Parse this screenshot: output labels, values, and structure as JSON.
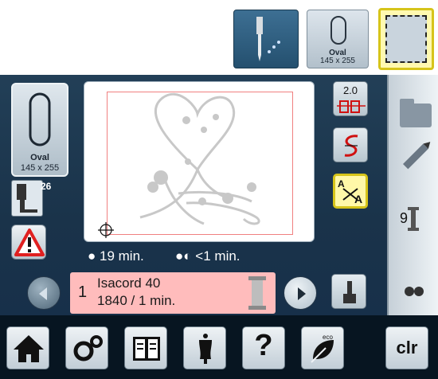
{
  "top": {
    "hoop_name": "Oval",
    "hoop_size": "145 x 255"
  },
  "hoop": {
    "name": "Oval",
    "size": "145 x 255"
  },
  "presser_foot": {
    "number": "26"
  },
  "scale": {
    "value": "2.0"
  },
  "times": {
    "total": "19 min.",
    "color": "<1 min."
  },
  "thread": {
    "index": "1",
    "brand": "Isacord 40",
    "detail": "1840 / 1 min.",
    "color": "#ffbcbc"
  },
  "side_menu": {
    "needle_count": "9"
  },
  "bottom": {
    "help_label": "?",
    "eco_label": "eco",
    "clr_label": "clr"
  },
  "colors": {
    "panel": "#1a334a",
    "accent_yellow": "#d6c41a",
    "stitch_frame": "#f08080",
    "thread_bar": "#ffbcbc"
  }
}
